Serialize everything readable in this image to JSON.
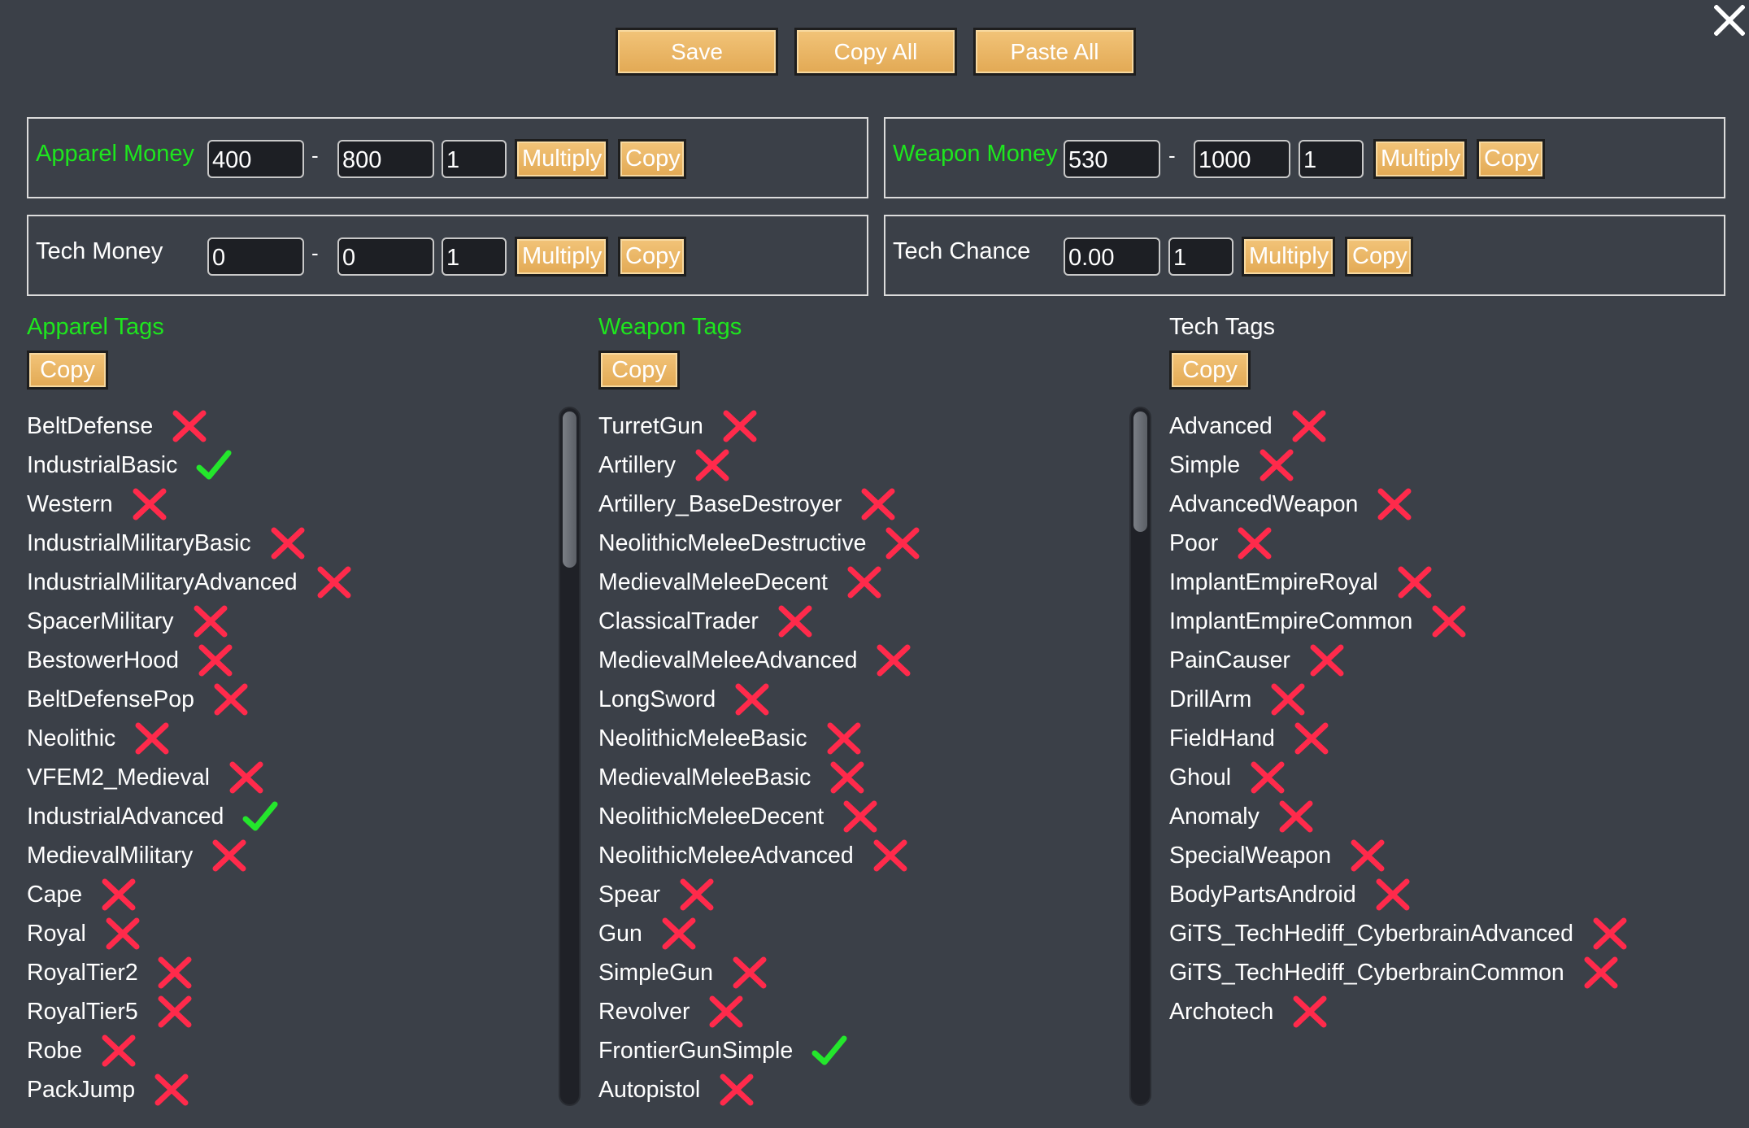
{
  "toolbar": {
    "save_label": "Save",
    "copy_all_label": "Copy All",
    "paste_all_label": "Paste All"
  },
  "buttons": {
    "multiply": "Multiply",
    "copy": "Copy"
  },
  "apparel_money": {
    "label": "Apparel Money",
    "min": "400",
    "max": "800",
    "factor": "1"
  },
  "weapon_money": {
    "label": "Weapon Money",
    "min": "530",
    "max": "1000",
    "factor": "1"
  },
  "tech_money": {
    "label": "Tech Money",
    "min": "0",
    "max": "0",
    "factor": "1"
  },
  "tech_chance": {
    "label": "Tech Chance",
    "value": "0.00",
    "factor": "1"
  },
  "range_separator": "-",
  "colors": {
    "accent_green": "#1ee61e",
    "button_gold": "#e8b464",
    "cross_red": "#ff2a4b",
    "check_green": "#24e62c",
    "background": "#3b4048"
  },
  "apparel_tags": {
    "title": "Apparel Tags",
    "copy_label": "Copy",
    "items": [
      {
        "name": "BeltDefense",
        "state": "cross"
      },
      {
        "name": "IndustrialBasic",
        "state": "check"
      },
      {
        "name": "Western",
        "state": "cross"
      },
      {
        "name": "IndustrialMilitaryBasic",
        "state": "cross"
      },
      {
        "name": "IndustrialMilitaryAdvanced",
        "state": "cross"
      },
      {
        "name": "SpacerMilitary",
        "state": "cross"
      },
      {
        "name": "BestowerHood",
        "state": "cross"
      },
      {
        "name": "BeltDefensePop",
        "state": "cross"
      },
      {
        "name": "Neolithic",
        "state": "cross"
      },
      {
        "name": "VFEM2_Medieval",
        "state": "cross"
      },
      {
        "name": "IndustrialAdvanced",
        "state": "check"
      },
      {
        "name": "MedievalMilitary",
        "state": "cross"
      },
      {
        "name": "Cape",
        "state": "cross"
      },
      {
        "name": "Royal",
        "state": "cross"
      },
      {
        "name": "RoyalTier2",
        "state": "cross"
      },
      {
        "name": "RoyalTier5",
        "state": "cross"
      },
      {
        "name": "Robe",
        "state": "cross"
      },
      {
        "name": "PackJump",
        "state": "cross"
      }
    ]
  },
  "weapon_tags": {
    "title": "Weapon Tags",
    "copy_label": "Copy",
    "items": [
      {
        "name": "TurretGun",
        "state": "cross"
      },
      {
        "name": "Artillery",
        "state": "cross"
      },
      {
        "name": "Artillery_BaseDestroyer",
        "state": "cross"
      },
      {
        "name": "NeolithicMeleeDestructive",
        "state": "cross"
      },
      {
        "name": "MedievalMeleeDecent",
        "state": "cross"
      },
      {
        "name": "ClassicalTrader",
        "state": "cross"
      },
      {
        "name": "MedievalMeleeAdvanced",
        "state": "cross"
      },
      {
        "name": "LongSword",
        "state": "cross"
      },
      {
        "name": "NeolithicMeleeBasic",
        "state": "cross"
      },
      {
        "name": "MedievalMeleeBasic",
        "state": "cross"
      },
      {
        "name": "NeolithicMeleeDecent",
        "state": "cross"
      },
      {
        "name": "NeolithicMeleeAdvanced",
        "state": "cross"
      },
      {
        "name": "Spear",
        "state": "cross"
      },
      {
        "name": "Gun",
        "state": "cross"
      },
      {
        "name": "SimpleGun",
        "state": "cross"
      },
      {
        "name": "Revolver",
        "state": "cross"
      },
      {
        "name": "FrontierGunSimple",
        "state": "check"
      },
      {
        "name": "Autopistol",
        "state": "cross"
      }
    ]
  },
  "tech_tags": {
    "title": "Tech Tags",
    "copy_label": "Copy",
    "items": [
      {
        "name": "Advanced",
        "state": "cross"
      },
      {
        "name": "Simple",
        "state": "cross"
      },
      {
        "name": "AdvancedWeapon",
        "state": "cross"
      },
      {
        "name": "Poor",
        "state": "cross"
      },
      {
        "name": "ImplantEmpireRoyal",
        "state": "cross"
      },
      {
        "name": "ImplantEmpireCommon",
        "state": "cross"
      },
      {
        "name": "PainCauser",
        "state": "cross"
      },
      {
        "name": "DrillArm",
        "state": "cross"
      },
      {
        "name": "FieldHand",
        "state": "cross"
      },
      {
        "name": "Ghoul",
        "state": "cross"
      },
      {
        "name": "Anomaly",
        "state": "cross"
      },
      {
        "name": "SpecialWeapon",
        "state": "cross"
      },
      {
        "name": "BodyPartsAndroid",
        "state": "cross"
      },
      {
        "name": "GiTS_TechHediff_CyberbrainAdvanced",
        "state": "cross"
      },
      {
        "name": "GiTS_TechHediff_CyberbrainCommon",
        "state": "cross"
      },
      {
        "name": "Archotech",
        "state": "cross"
      }
    ]
  }
}
